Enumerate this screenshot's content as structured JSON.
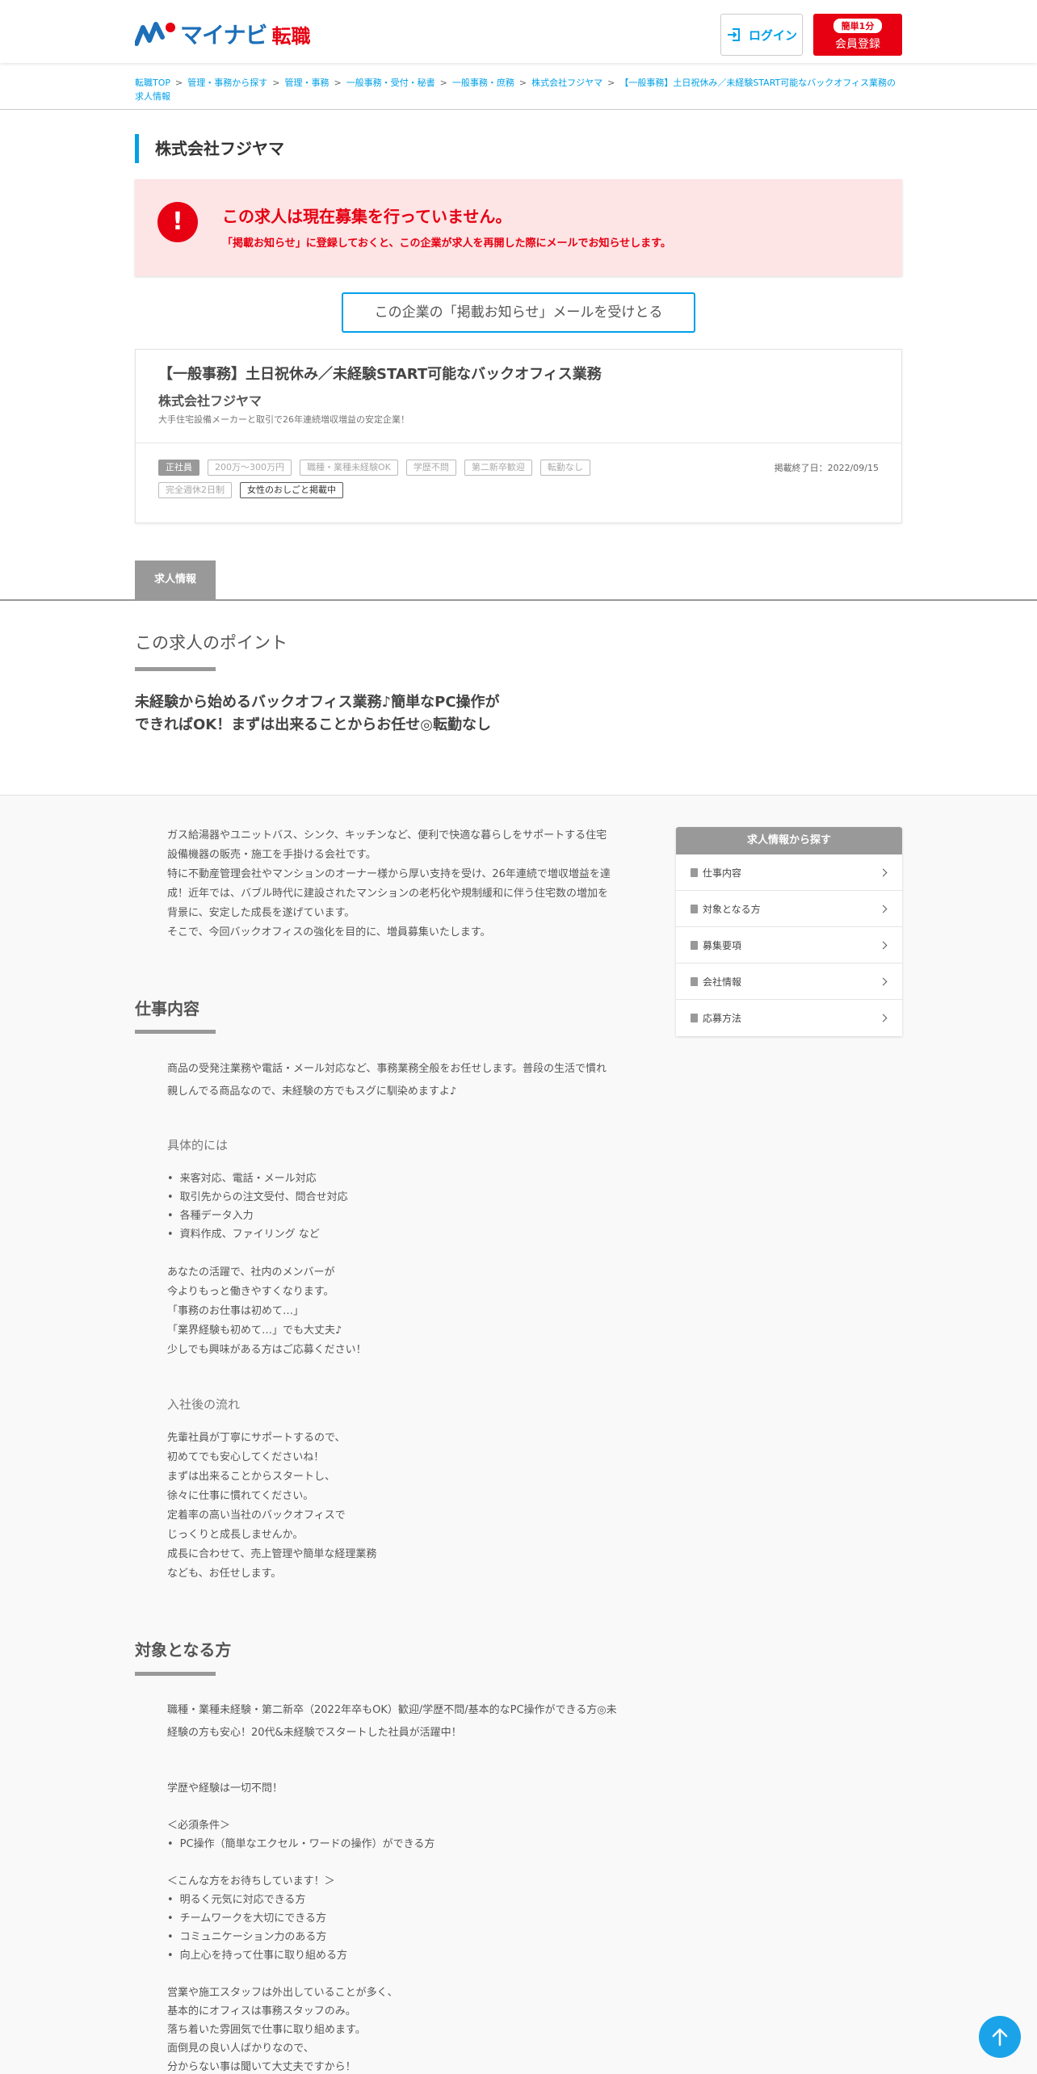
{
  "header": {
    "logo_main": "マイナビ",
    "logo_sub": "転職",
    "login_label": "ログイン",
    "register_badge": "簡単1分",
    "register_label": "会員登録"
  },
  "breadcrumb": [
    "転職TOP",
    "管理・事務から探す",
    "管理・事務",
    "一般事務・受付・秘書",
    "一般事務・庶務",
    "株式会社フジヤマ",
    "【一般事務】土日祝休み／未経験START可能なバックオフィス業務の求人情報"
  ],
  "company_name": "株式会社フジヤマ",
  "alert": {
    "icon": "!",
    "title": "この求人は現在募集を行っていません。",
    "sub": "「掲載お知らせ」に登録しておくと、この企業が求人を再開した際にメールでお知らせします。"
  },
  "notify_button": "この企業の「掲載お知らせ」メールを受けとる",
  "job": {
    "title": "【一般事務】土日祝休み／未経験START可能なバックオフィス業務",
    "company": "株式会社フジヤマ",
    "catch": "大手住宅設備メーカーと取引で26年連続増収増益の安定企業！",
    "tags": [
      "正社員",
      "200万～300万円",
      "職種・業種未経験OK",
      "学歴不問",
      "第二新卒歓迎",
      "転勤なし",
      "完全週休2日制",
      "女性のおしごと掲載中"
    ],
    "end_date": "掲載終了日：2022/09/15"
  },
  "tab_label": "求人情報",
  "point": {
    "heading": "この求人のポイント",
    "body_line1": "未経験から始めるバックオフィス業務♪簡単なPC操作が",
    "body_line2": "できればOK！まずは出来ることからお任せ◎転勤なし"
  },
  "intro": [
    "ガス給湯器やユニットバス、シンク、キッチンなど、便利で快適な暮らしをサポートする住宅",
    "設備機器の販売・施工を手掛ける会社です。",
    "特に不動産管理会社やマンションのオーナー様から厚い支持を受け、26年連続で増収増益を達",
    "成！近年では、バブル時代に建設されたマンションの老朽化や規制緩和に伴う住宅数の増加を",
    "背景に、安定した成長を遂げています。",
    "そこで、今回バックオフィスの強化を目的に、増員募集いたします。"
  ],
  "sidebar": {
    "head": "求人情報から探す",
    "items": [
      "仕事内容",
      "対象となる方",
      "募集要項",
      "会社情報",
      "応募方法"
    ]
  },
  "work": {
    "heading": "仕事内容",
    "summary_line1": "商品の受発注業務や電話・メール対応など、事務業務全般をお任せします。普段の生活で慣れ",
    "summary_line2": "親しんでる商品なので、未経験の方でもスグに馴染めますよ♪",
    "specific_heading": "具体的には",
    "specific_items": [
      "来客対応、電話・メール対応",
      "取引先からの注文受付、問合せ対応",
      "各種データ入力",
      "資料作成、ファイリング など"
    ],
    "message": [
      "あなたの活躍で、社内のメンバーが",
      "今よりもっと働きやすくなります。",
      "「事務のお仕事は初めて…」",
      "「業界経験も初めて…」でも大丈夫♪",
      "少しでも興味がある方はご応募ください！"
    ],
    "flow_heading": "入社後の流れ",
    "flow": [
      "先輩社員が丁寧にサポートするので、",
      "初めてでも安心してくださいね！",
      "まずは出来ることからスタートし、",
      "徐々に仕事に慣れてください。",
      "定着率の高い当社のバックオフィスで",
      "じっくりと成長しませんか。",
      "成長に合わせて、売上管理や簡単な経理業務",
      "なども、お任せします。"
    ]
  },
  "target": {
    "heading": "対象となる方",
    "summary_line1": "職種・業種未経験・第二新卒（2022年卒もOK）歓迎/学歴不問/基本的なPC操作ができる方◎未",
    "summary_line2": "経験の方も安心！20代&未経験でスタートした社員が活躍中！",
    "education": "学歴や経験は一切不問！",
    "required_heading": "＜必須条件＞",
    "required": [
      "PC操作（簡単なエクセル・ワードの操作）ができる方"
    ],
    "wanted_heading": "＜こんな方をお待ちしています！＞",
    "wanted": [
      "明るく元気に対応できる方",
      "チームワークを大切にできる方",
      "コミュニケーション力のある方",
      "向上心を持って仕事に取り組める方"
    ],
    "office": [
      "営業や施工スタッフは外出していることが多く、",
      "基本的にオフィスは事務スタッフのみ。",
      "落ち着いた雰囲気で仕事に取り組めます。",
      "面倒見の良い人ばかりなので、",
      "分からない事は聞いて大丈夫ですから！"
    ]
  },
  "colors": {
    "brand_blue": "#1d6fb8",
    "accent_cyan": "#00a0e9",
    "alert_red": "#e60012",
    "alert_bg": "#fde4e5"
  }
}
